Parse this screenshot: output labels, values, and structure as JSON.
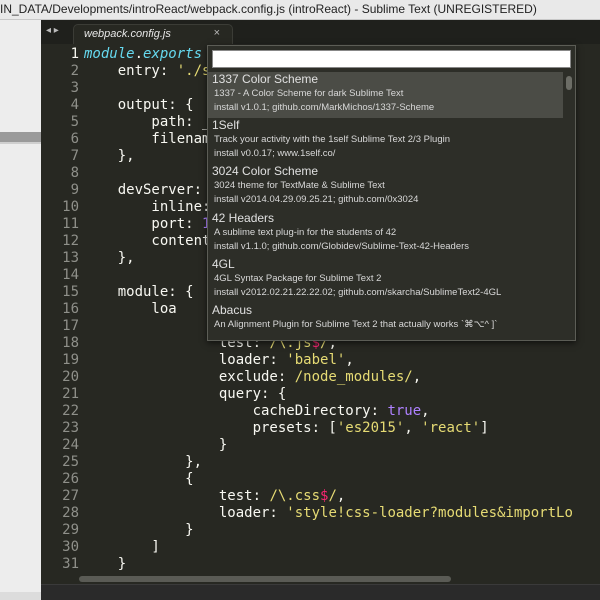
{
  "window": {
    "title": "IN_DATA/Developments/introReact/webpack.config.js (introReact) - Sublime Text (UNREGISTERED)"
  },
  "tabs": [
    {
      "label": "webpack.config.js",
      "close": "×"
    }
  ],
  "nav": {
    "arrows": "◂ ▸"
  },
  "editor": {
    "line_numbers": [
      "1",
      "2",
      "3",
      "4",
      "5",
      "6",
      "7",
      "8",
      "9",
      "10",
      "11",
      "12",
      "13",
      "14",
      "15",
      "16",
      "17",
      "18",
      "19",
      "20",
      "21",
      "22",
      "23",
      "24",
      "25",
      "26",
      "27",
      "28",
      "29",
      "30",
      "31"
    ],
    "active_line": 1,
    "lines": [
      [
        {
          "t": "module",
          "c": "#66d9ef",
          "i": true
        },
        {
          "t": ".",
          "c": "#f8f8f2"
        },
        {
          "t": "exports",
          "c": "#66d9ef",
          "i": true
        },
        {
          "t": " ",
          "c": "#f8f8f2"
        }
      ],
      [
        {
          "t": "    entry: ",
          "c": "#f8f8f2"
        },
        {
          "t": "'./s",
          "c": "#e6db74"
        }
      ],
      [],
      [
        {
          "t": "    output: {",
          "c": "#f8f8f2"
        }
      ],
      [
        {
          "t": "        path: _",
          "c": "#f8f8f2"
        }
      ],
      [
        {
          "t": "        filenam",
          "c": "#f8f8f2"
        }
      ],
      [
        {
          "t": "    },",
          "c": "#f8f8f2"
        }
      ],
      [],
      [
        {
          "t": "    devServer: ",
          "c": "#f8f8f2"
        }
      ],
      [
        {
          "t": "        inline:",
          "c": "#f8f8f2"
        }
      ],
      [
        {
          "t": "        port: ",
          "c": "#f8f8f2"
        },
        {
          "t": "1",
          "c": "#ae81ff"
        }
      ],
      [
        {
          "t": "        content",
          "c": "#f8f8f2"
        }
      ],
      [
        {
          "t": "    },",
          "c": "#f8f8f2"
        }
      ],
      [],
      [
        {
          "t": "    module: {",
          "c": "#f8f8f2"
        }
      ],
      [
        {
          "t": "        loa",
          "c": "#f8f8f2"
        }
      ],
      [],
      [
        {
          "t": "                test: ",
          "c": "#f8f8f2"
        },
        {
          "t": "/\\.js",
          "c": "#e6db74"
        },
        {
          "t": "$",
          "c": "#f92672"
        },
        {
          "t": "/",
          "c": "#e6db74"
        },
        {
          "t": ",",
          "c": "#f8f8f2"
        }
      ],
      [
        {
          "t": "                loader: ",
          "c": "#f8f8f2"
        },
        {
          "t": "'babel'",
          "c": "#e6db74"
        },
        {
          "t": ",",
          "c": "#f8f8f2"
        }
      ],
      [
        {
          "t": "                exclude: ",
          "c": "#f8f8f2"
        },
        {
          "t": "/node_modules/",
          "c": "#e6db74"
        },
        {
          "t": ",",
          "c": "#f8f8f2"
        }
      ],
      [
        {
          "t": "                query: {",
          "c": "#f8f8f2"
        }
      ],
      [
        {
          "t": "                    cacheDirectory: ",
          "c": "#f8f8f2"
        },
        {
          "t": "true",
          "c": "#ae81ff"
        },
        {
          "t": ",",
          "c": "#f8f8f2"
        }
      ],
      [
        {
          "t": "                    presets: [",
          "c": "#f8f8f2"
        },
        {
          "t": "'es2015'",
          "c": "#e6db74"
        },
        {
          "t": ", ",
          "c": "#f8f8f2"
        },
        {
          "t": "'react'",
          "c": "#e6db74"
        },
        {
          "t": "]",
          "c": "#f8f8f2"
        }
      ],
      [
        {
          "t": "                }",
          "c": "#f8f8f2"
        }
      ],
      [
        {
          "t": "            },",
          "c": "#f8f8f2"
        }
      ],
      [
        {
          "t": "            {",
          "c": "#f8f8f2"
        }
      ],
      [
        {
          "t": "                test: ",
          "c": "#f8f8f2"
        },
        {
          "t": "/\\.css",
          "c": "#e6db74"
        },
        {
          "t": "$",
          "c": "#f92672"
        },
        {
          "t": "/",
          "c": "#e6db74"
        },
        {
          "t": ",",
          "c": "#f8f8f2"
        }
      ],
      [
        {
          "t": "                loader: ",
          "c": "#f8f8f2"
        },
        {
          "t": "'style!css-loader?modules&importLo",
          "c": "#e6db74"
        }
      ],
      [
        {
          "t": "            }",
          "c": "#f8f8f2"
        }
      ],
      [
        {
          "t": "        ]",
          "c": "#f8f8f2"
        }
      ],
      [
        {
          "t": "    }",
          "c": "#f8f8f2"
        }
      ]
    ]
  },
  "palette": {
    "search_value": "",
    "results": [
      {
        "name": "1337 Color Scheme",
        "description": "1337 - A Color Scheme for dark Sublime Text",
        "install": "install v1.0.1; github.com/MarkMichos/1337-Scheme",
        "selected": true
      },
      {
        "name": "1Self",
        "description": "Track your activity with the 1self Sublime Text 2/3 Plugin",
        "install": "install v0.0.17; www.1self.co/",
        "selected": false
      },
      {
        "name": "3024 Color Scheme",
        "description": "3024 theme for TextMate & Sublime Text",
        "install": "install v2014.04.29.09.25.21; github.com/0x3024",
        "selected": false
      },
      {
        "name": "42 Headers",
        "description": "A sublime text plug-in for the students of 42",
        "install": "install v1.1.0; github.com/Globidev/Sublime-Text-42-Headers",
        "selected": false
      },
      {
        "name": "4GL",
        "description": "4GL Syntax Package for Sublime Text 2",
        "install": "install v2012.02.21.22.22.02; github.com/skarcha/SublimeText2-4GL",
        "selected": false
      },
      {
        "name": "Abacus",
        "description": "An Alignment Plugin for Sublime Text 2 that actually works `⌘⌥^ ]`",
        "install": "",
        "selected": false
      }
    ]
  },
  "colors": {
    "editor_bg": "#272822",
    "keyword_blue": "#66d9ef",
    "string_yellow": "#e6db74",
    "number_purple": "#ae81ff",
    "operator_pink": "#f92672",
    "selection_bg": "#4b4c46"
  }
}
